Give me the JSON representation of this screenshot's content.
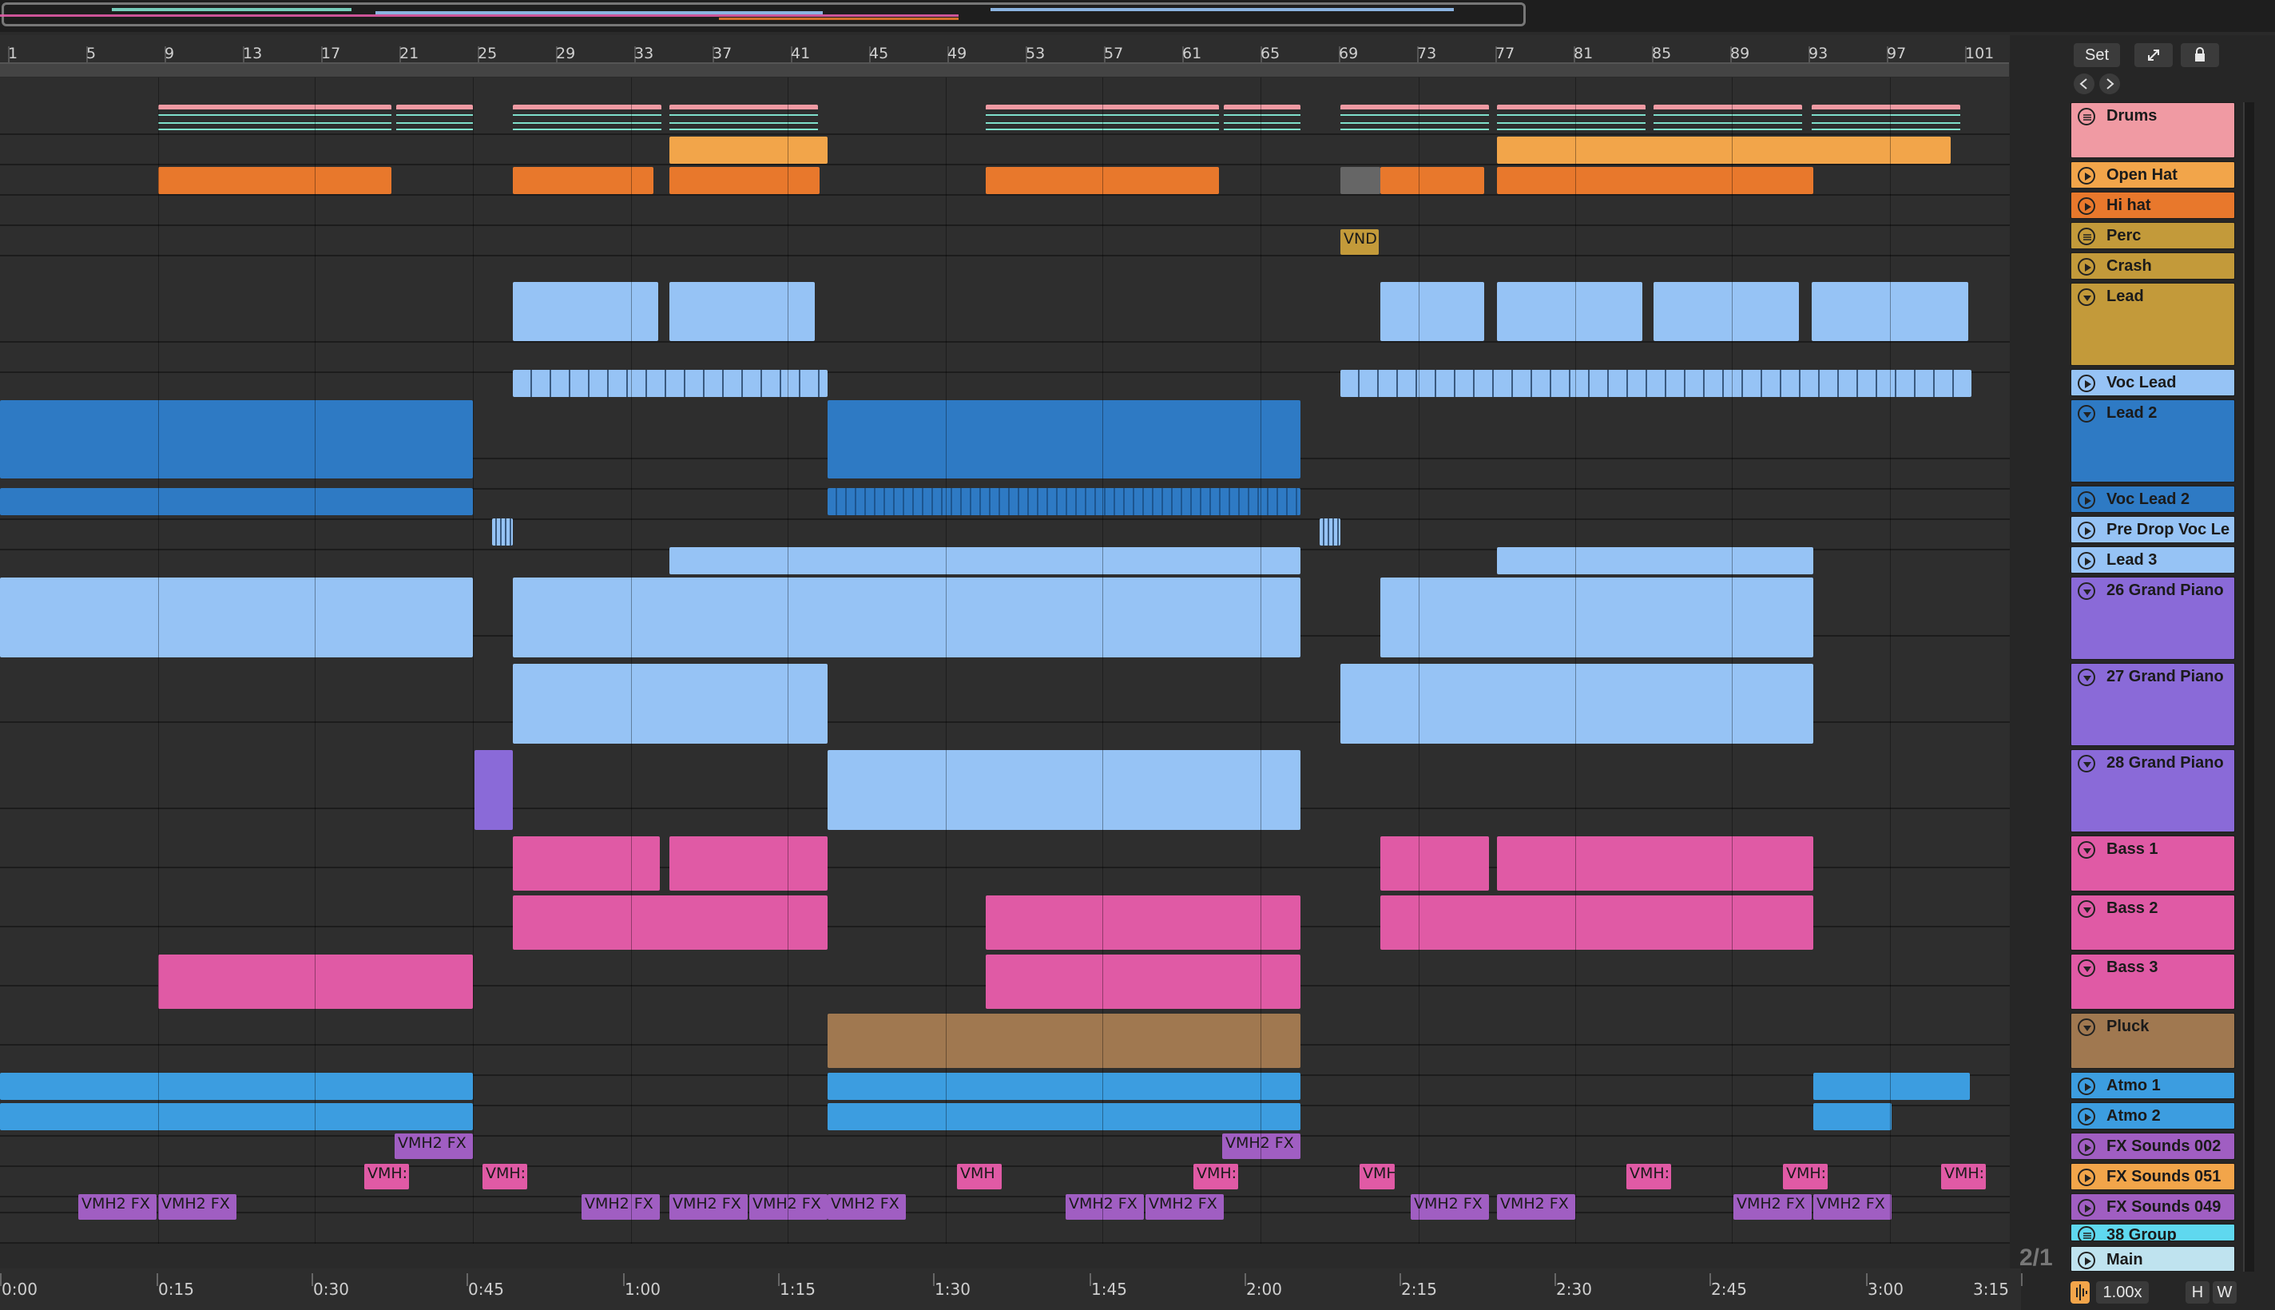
{
  "overview": {
    "label": "arrangement-overview"
  },
  "ruler": {
    "bars": [
      "1",
      "5",
      "9",
      "13",
      "17",
      "21",
      "25",
      "29",
      "33",
      "37",
      "41",
      "45",
      "49",
      "53",
      "57",
      "61",
      "65",
      "69",
      "73",
      "77",
      "81",
      "85",
      "89",
      "93",
      "97",
      "101"
    ]
  },
  "timeline": {
    "labels": [
      "0:00",
      "0:15",
      "0:30",
      "0:45",
      "1:00",
      "1:15",
      "1:30",
      "1:45",
      "2:00",
      "2:15",
      "2:30",
      "2:45",
      "3:00",
      "3:15"
    ]
  },
  "controls": {
    "set_label": "Set",
    "expand_icon": "expand-icon",
    "lock_icon": "lock-icon",
    "back_icon": "back-arrow-icon",
    "forward_icon": "forward-arrow-icon",
    "zoom_ratio": "2/1",
    "zoom_value": "1.00x",
    "h_label": "H",
    "w_label": "W"
  },
  "colors": {
    "drums": "#f09aa3",
    "open_hat": "#f2a54a",
    "hi_hat": "#e8782c",
    "gold": "#c39a3a",
    "light_blue": "#96c3f5",
    "blue": "#2e7ac4",
    "purple": "#8a6ad8",
    "pink": "#e05aa5",
    "brown": "#a07850",
    "sky": "#3c9de0",
    "violet": "#a05ec2",
    "cyan": "#5fd8ef",
    "teal": "#7fe0cc"
  },
  "clip_labels": {
    "vnd": "VND",
    "vmh_long": "VMH2 FX",
    "vmh_short": "VMH",
    "vmh_cut": "VMH:"
  },
  "tracks": [
    {
      "name": "Drums",
      "icon": "group-fold-icon"
    },
    {
      "name": "Open Hat",
      "icon": "play-icon"
    },
    {
      "name": "Hi hat",
      "icon": "play-icon"
    },
    {
      "name": "Perc",
      "icon": "group-fold-icon"
    },
    {
      "name": "Crash",
      "icon": "play-icon"
    },
    {
      "name": "Lead",
      "icon": "fold-icon"
    },
    {
      "name": "Voc Lead",
      "icon": "play-icon"
    },
    {
      "name": "Lead 2",
      "icon": "fold-icon"
    },
    {
      "name": "Voc Lead 2",
      "icon": "play-icon"
    },
    {
      "name": "Pre Drop Voc Le",
      "icon": "play-icon"
    },
    {
      "name": "Lead 3",
      "icon": "play-icon"
    },
    {
      "name": "26 Grand Piano",
      "icon": "fold-icon"
    },
    {
      "name": "27 Grand Piano",
      "icon": "fold-icon"
    },
    {
      "name": "28 Grand Piano",
      "icon": "fold-icon"
    },
    {
      "name": "Bass 1",
      "icon": "fold-icon"
    },
    {
      "name": "Bass 2",
      "icon": "fold-icon"
    },
    {
      "name": "Bass 3",
      "icon": "fold-icon"
    },
    {
      "name": "Pluck",
      "icon": "fold-icon"
    },
    {
      "name": "Atmo 1",
      "icon": "play-icon"
    },
    {
      "name": "Atmo 2",
      "icon": "play-icon"
    },
    {
      "name": "FX Sounds 002",
      "icon": "play-icon"
    },
    {
      "name": "FX Sounds 051",
      "icon": "play-icon"
    },
    {
      "name": "FX Sounds 049",
      "icon": "play-icon"
    },
    {
      "name": "38 Group",
      "icon": "group-fold-icon"
    },
    {
      "name": "Main",
      "icon": "play-icon"
    }
  ]
}
